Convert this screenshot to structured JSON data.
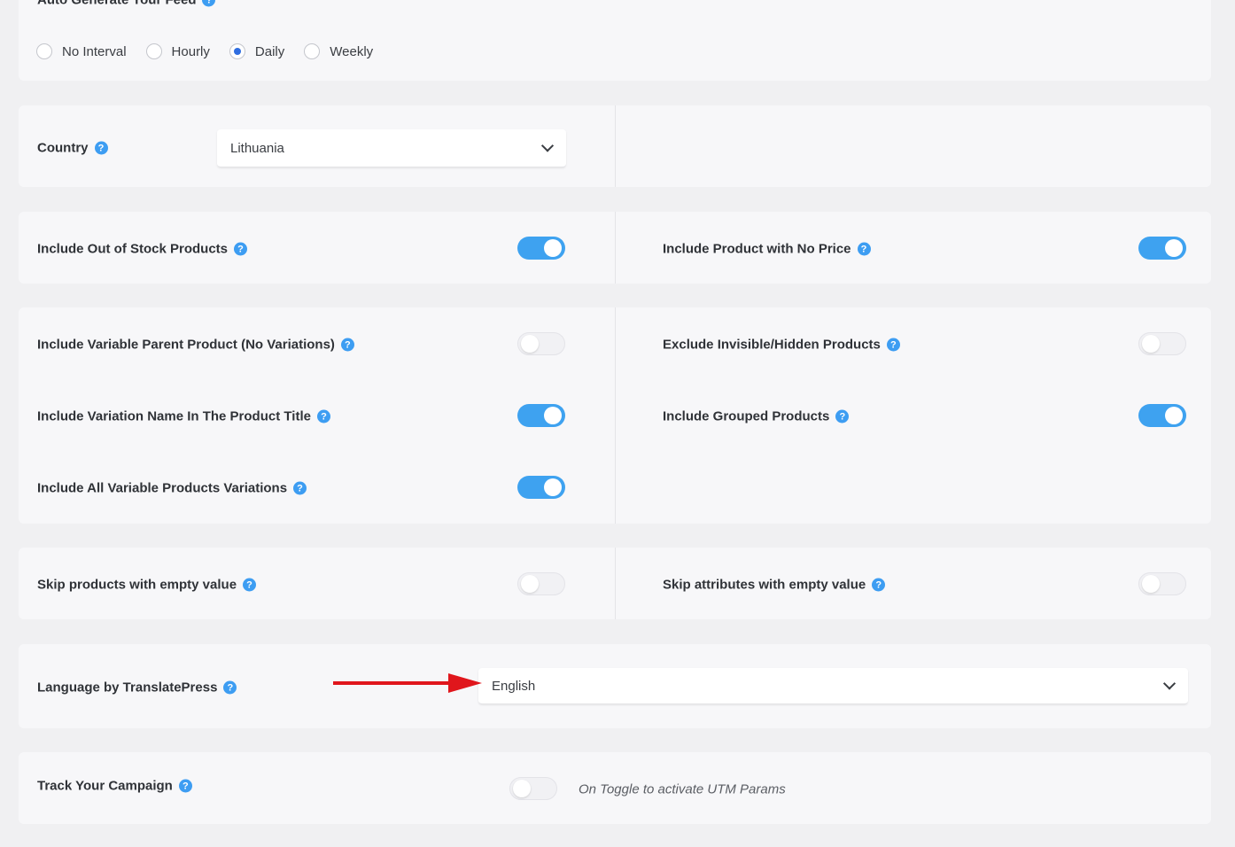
{
  "auto_generate": {
    "label": "Auto Generate Your Feed",
    "options": [
      {
        "label": "No Interval",
        "checked": false
      },
      {
        "label": "Hourly",
        "checked": false
      },
      {
        "label": "Daily",
        "checked": true
      },
      {
        "label": "Weekly",
        "checked": false
      }
    ]
  },
  "country": {
    "label": "Country",
    "value": "Lithuania"
  },
  "stock_row": {
    "out_of_stock": {
      "label": "Include Out of Stock Products",
      "on": true
    },
    "no_price": {
      "label": "Include Product with No Price",
      "on": true
    }
  },
  "variations": {
    "variable_parent": {
      "label": "Include Variable Parent Product (No Variations)",
      "on": false
    },
    "exclude_hidden": {
      "label": "Exclude Invisible/Hidden Products",
      "on": false
    },
    "variation_name": {
      "label": "Include Variation Name In The Product Title",
      "on": true
    },
    "grouped": {
      "label": "Include Grouped Products",
      "on": true
    },
    "all_variations": {
      "label": "Include All Variable Products Variations",
      "on": true
    }
  },
  "empty_values": {
    "skip_products": {
      "label": "Skip products with empty value",
      "on": false
    },
    "skip_attributes": {
      "label": "Skip attributes with empty value",
      "on": false
    }
  },
  "language": {
    "label": "Language by TranslatePress",
    "value": "English"
  },
  "campaign": {
    "label": "Track Your Campaign",
    "on": false,
    "hint": "On Toggle to activate UTM Params"
  },
  "help_glyph": "?",
  "colors": {
    "accent": "#3ea2f0",
    "help": "#3d9df2",
    "arrow": "#e0161c",
    "radio": "#2f6de0"
  }
}
